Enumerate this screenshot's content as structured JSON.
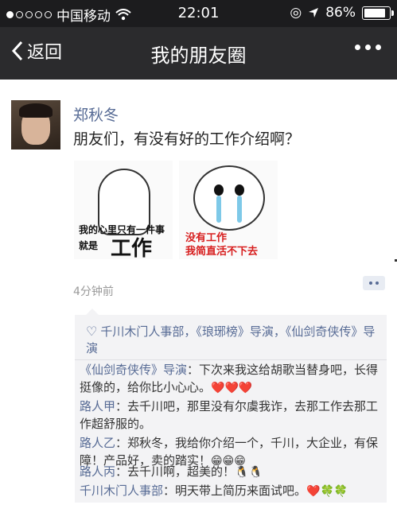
{
  "status_bar": {
    "carrier": "中国移动",
    "time": "22:01",
    "battery": "86%"
  },
  "nav": {
    "back_label": "返回",
    "title": "我的朋友圈"
  },
  "post": {
    "author": "郑秋冬",
    "text": "朋友们，有没有好的工作介绍啊？",
    "images": [
      {
        "line1": "我的心里只有一件事",
        "line2": "就是",
        "big": "工作"
      },
      {
        "line1": "没有工作",
        "line2": "我简直活不下去"
      }
    ],
    "time_ago": "4分钟前"
  },
  "likes": {
    "names": "千川木门人事部，《琅琊榜》导演，《仙剑奇侠传》导演"
  },
  "comments": [
    {
      "name": "《仙剑奇侠传》导演",
      "text": "：下次来我这给胡歌当替身吧，长得挺像的，给你比小心心。",
      "emoji": "❤️❤️❤️"
    },
    {
      "name": "路人甲",
      "text": "：去千川吧，那里没有尔虞我诈，去那工作去那工作超舒服的。",
      "emoji": ""
    },
    {
      "name": "路人乙",
      "text": "：郑秋冬，我给你介绍一个，千川，大企业，有保障！产品好，卖的踏实！",
      "emoji": "😁😁😁"
    },
    {
      "name": "路人丙",
      "text": "：去千川啊，超美的！",
      "emoji": "🐧🐧"
    },
    {
      "name": "千川木门人事部",
      "text": "：明天带上简历来面试吧。",
      "emoji": "❤️🍀🍀"
    }
  ]
}
